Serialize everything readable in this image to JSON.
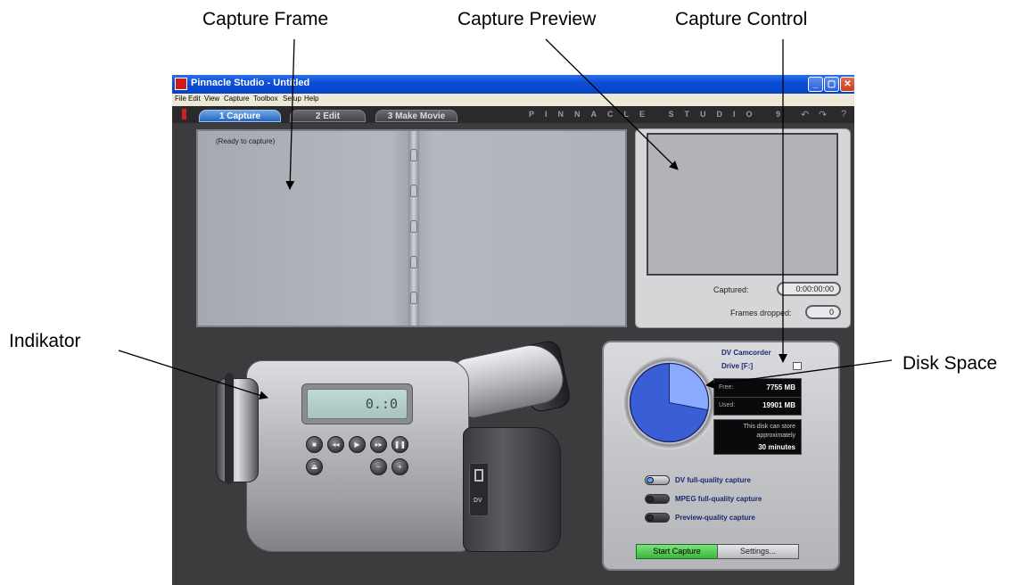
{
  "annotations": {
    "capture_frame": "Capture Frame",
    "capture_preview": "Capture Preview",
    "capture_control": "Capture Control",
    "indikator": "Indikator",
    "disk_space": "Disk Space"
  },
  "window": {
    "title": "Pinnacle Studio - Untitled",
    "min_glyph": "_",
    "max_glyph": "▢",
    "close_glyph": "✕"
  },
  "menu": [
    "File",
    "Edit",
    "View",
    "Capture",
    "Toolbox",
    "Setup",
    "Help"
  ],
  "tabs": [
    "1 Capture",
    "2 Edit",
    "3 Make Movie"
  ],
  "brand": "PINNACLE STUDIO 9",
  "toolbar_icons": [
    "undo-icon",
    "redo-icon",
    "help-icon"
  ],
  "toolbar_glyphs": {
    "undo": "↶",
    "redo": "↷",
    "help": "?"
  },
  "album": {
    "status": "(Ready to capture)"
  },
  "preview": {
    "captured_label": "Captured:",
    "captured_value": "0:00:00:00",
    "dropped_label": "Frames dropped:",
    "dropped_value": "0"
  },
  "camcorder": {
    "lcd_text": "0.:0",
    "port_label": "DV",
    "buttons": [
      "■",
      "◂◂",
      "▶",
      "▸▸",
      "❚❚",
      "⏏",
      "−",
      "+"
    ]
  },
  "capture_control": {
    "source": "DV Camcorder",
    "drive": "Drive [F:]",
    "free_label": "Free:",
    "free_value": "7755 MB",
    "used_label": "Used:",
    "used_value": "19901 MB",
    "store_text_1": "This disk can store",
    "store_text_2": "approximately",
    "store_time": "30 minutes",
    "used_fraction": 0.72,
    "options": [
      {
        "label": "DV full-quality capture",
        "selected": true
      },
      {
        "label": "MPEG full-quality capture",
        "selected": false
      },
      {
        "label": "Preview-quality capture",
        "selected": false
      }
    ],
    "start_label": "Start Capture",
    "settings_label": "Settings...",
    "colors": {
      "used": "#3a5ed6",
      "free": "#8aaaff"
    }
  }
}
